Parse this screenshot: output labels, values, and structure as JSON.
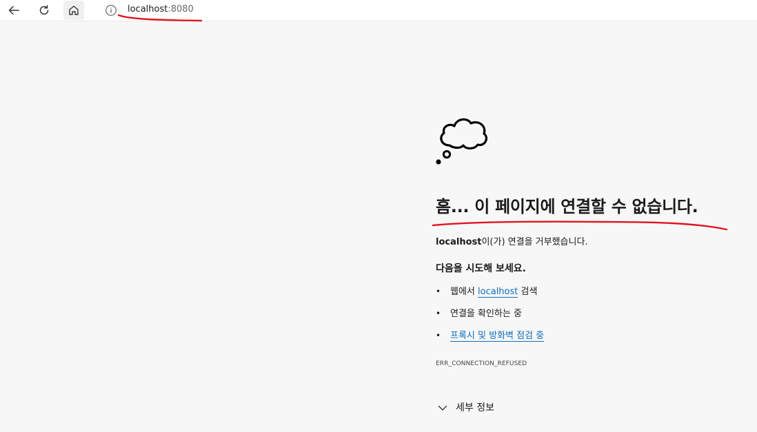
{
  "browser": {
    "url_host": "localhost",
    "url_port": ":8080",
    "icons": {
      "back": "arrow-left-icon",
      "refresh": "refresh-icon",
      "home": "home-icon",
      "info": "info-icon"
    }
  },
  "error_page": {
    "icon": "thought-cloud-icon",
    "title": "흠... 이 페이지에 연결할 수 없습니다.",
    "refused_host": "localhost",
    "refused_suffix": "이(가) 연결을 거부했습니다.",
    "try_heading": "다음을 시도해 보세요.",
    "suggestions": {
      "bullet": "•",
      "search_prefix": "웹에서 ",
      "search_link": "localhost",
      "search_suffix": " 검색",
      "check_connection": "연결을 확인하는 중",
      "proxy_link": "프록시 및 방화벽 점검 중"
    },
    "error_code": "ERR_CONNECTION_REFUSED",
    "details_label": "세부 정보"
  },
  "colors": {
    "page_background": "#f7f7f7",
    "link": "#0f6cbd",
    "annotation": "#e0141e"
  }
}
